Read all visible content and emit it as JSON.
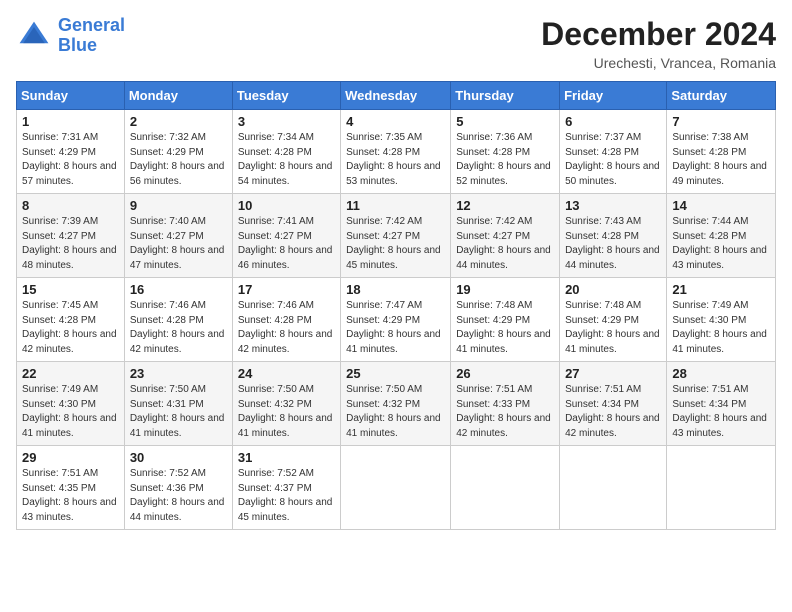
{
  "header": {
    "logo_line1": "General",
    "logo_line2": "Blue",
    "month": "December 2024",
    "location": "Urechesti, Vrancea, Romania"
  },
  "days_of_week": [
    "Sunday",
    "Monday",
    "Tuesday",
    "Wednesday",
    "Thursday",
    "Friday",
    "Saturday"
  ],
  "weeks": [
    [
      {
        "day": "1",
        "sunrise": "7:31 AM",
        "sunset": "4:29 PM",
        "daylight": "8 hours and 57 minutes."
      },
      {
        "day": "2",
        "sunrise": "7:32 AM",
        "sunset": "4:29 PM",
        "daylight": "8 hours and 56 minutes."
      },
      {
        "day": "3",
        "sunrise": "7:34 AM",
        "sunset": "4:28 PM",
        "daylight": "8 hours and 54 minutes."
      },
      {
        "day": "4",
        "sunrise": "7:35 AM",
        "sunset": "4:28 PM",
        "daylight": "8 hours and 53 minutes."
      },
      {
        "day": "5",
        "sunrise": "7:36 AM",
        "sunset": "4:28 PM",
        "daylight": "8 hours and 52 minutes."
      },
      {
        "day": "6",
        "sunrise": "7:37 AM",
        "sunset": "4:28 PM",
        "daylight": "8 hours and 50 minutes."
      },
      {
        "day": "7",
        "sunrise": "7:38 AM",
        "sunset": "4:28 PM",
        "daylight": "8 hours and 49 minutes."
      }
    ],
    [
      {
        "day": "8",
        "sunrise": "7:39 AM",
        "sunset": "4:27 PM",
        "daylight": "8 hours and 48 minutes."
      },
      {
        "day": "9",
        "sunrise": "7:40 AM",
        "sunset": "4:27 PM",
        "daylight": "8 hours and 47 minutes."
      },
      {
        "day": "10",
        "sunrise": "7:41 AM",
        "sunset": "4:27 PM",
        "daylight": "8 hours and 46 minutes."
      },
      {
        "day": "11",
        "sunrise": "7:42 AM",
        "sunset": "4:27 PM",
        "daylight": "8 hours and 45 minutes."
      },
      {
        "day": "12",
        "sunrise": "7:42 AM",
        "sunset": "4:27 PM",
        "daylight": "8 hours and 44 minutes."
      },
      {
        "day": "13",
        "sunrise": "7:43 AM",
        "sunset": "4:28 PM",
        "daylight": "8 hours and 44 minutes."
      },
      {
        "day": "14",
        "sunrise": "7:44 AM",
        "sunset": "4:28 PM",
        "daylight": "8 hours and 43 minutes."
      }
    ],
    [
      {
        "day": "15",
        "sunrise": "7:45 AM",
        "sunset": "4:28 PM",
        "daylight": "8 hours and 42 minutes."
      },
      {
        "day": "16",
        "sunrise": "7:46 AM",
        "sunset": "4:28 PM",
        "daylight": "8 hours and 42 minutes."
      },
      {
        "day": "17",
        "sunrise": "7:46 AM",
        "sunset": "4:28 PM",
        "daylight": "8 hours and 42 minutes."
      },
      {
        "day": "18",
        "sunrise": "7:47 AM",
        "sunset": "4:29 PM",
        "daylight": "8 hours and 41 minutes."
      },
      {
        "day": "19",
        "sunrise": "7:48 AM",
        "sunset": "4:29 PM",
        "daylight": "8 hours and 41 minutes."
      },
      {
        "day": "20",
        "sunrise": "7:48 AM",
        "sunset": "4:29 PM",
        "daylight": "8 hours and 41 minutes."
      },
      {
        "day": "21",
        "sunrise": "7:49 AM",
        "sunset": "4:30 PM",
        "daylight": "8 hours and 41 minutes."
      }
    ],
    [
      {
        "day": "22",
        "sunrise": "7:49 AM",
        "sunset": "4:30 PM",
        "daylight": "8 hours and 41 minutes."
      },
      {
        "day": "23",
        "sunrise": "7:50 AM",
        "sunset": "4:31 PM",
        "daylight": "8 hours and 41 minutes."
      },
      {
        "day": "24",
        "sunrise": "7:50 AM",
        "sunset": "4:32 PM",
        "daylight": "8 hours and 41 minutes."
      },
      {
        "day": "25",
        "sunrise": "7:50 AM",
        "sunset": "4:32 PM",
        "daylight": "8 hours and 41 minutes."
      },
      {
        "day": "26",
        "sunrise": "7:51 AM",
        "sunset": "4:33 PM",
        "daylight": "8 hours and 42 minutes."
      },
      {
        "day": "27",
        "sunrise": "7:51 AM",
        "sunset": "4:34 PM",
        "daylight": "8 hours and 42 minutes."
      },
      {
        "day": "28",
        "sunrise": "7:51 AM",
        "sunset": "4:34 PM",
        "daylight": "8 hours and 43 minutes."
      }
    ],
    [
      {
        "day": "29",
        "sunrise": "7:51 AM",
        "sunset": "4:35 PM",
        "daylight": "8 hours and 43 minutes."
      },
      {
        "day": "30",
        "sunrise": "7:52 AM",
        "sunset": "4:36 PM",
        "daylight": "8 hours and 44 minutes."
      },
      {
        "day": "31",
        "sunrise": "7:52 AM",
        "sunset": "4:37 PM",
        "daylight": "8 hours and 45 minutes."
      },
      null,
      null,
      null,
      null
    ]
  ]
}
